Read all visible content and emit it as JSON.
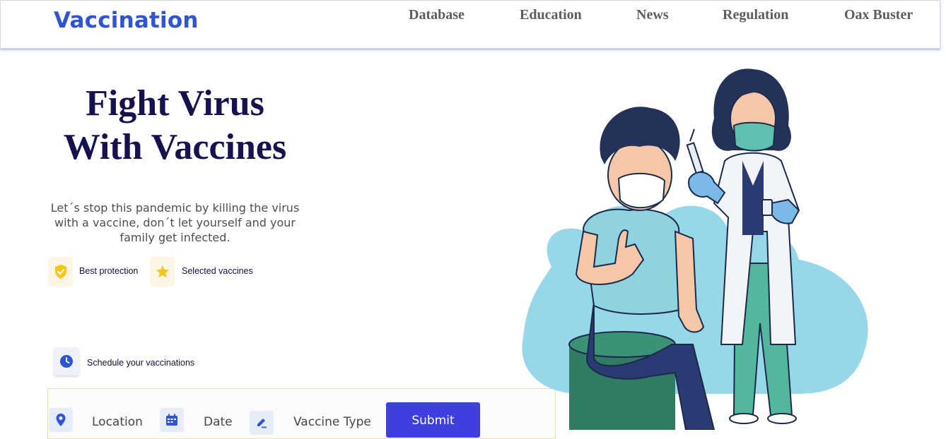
{
  "header": {
    "logo": "Vaccination",
    "nav": [
      "Database",
      "Education",
      "News",
      "Regulation",
      "Oax Buster"
    ]
  },
  "hero": {
    "title_line1": "Fight Virus",
    "title_line2": "With Vaccines",
    "description": "Let´s stop this pandemic by killing the virus with a vaccine, don´t let yourself and your family get infected."
  },
  "features": [
    {
      "label": "Best protection",
      "icon": "shield-check-icon"
    },
    {
      "label": "Selected vaccines",
      "icon": "star-icon"
    }
  ],
  "schedule": {
    "label": "Schedule your vaccinations",
    "icon": "clock-icon"
  },
  "form": {
    "fields": [
      {
        "label": "Location",
        "icon": "location-pin-icon"
      },
      {
        "label": "Date",
        "icon": "calendar-icon"
      },
      {
        "label": "Vaccine Type",
        "icon": "edit-icon"
      }
    ],
    "submit_label": "Submit"
  },
  "colors": {
    "brand": "#2f55d4",
    "heading": "#16124f",
    "submit": "#3f3fe0",
    "accent_gold": "#f5c518",
    "illustration_blob": "#96d8ea"
  }
}
